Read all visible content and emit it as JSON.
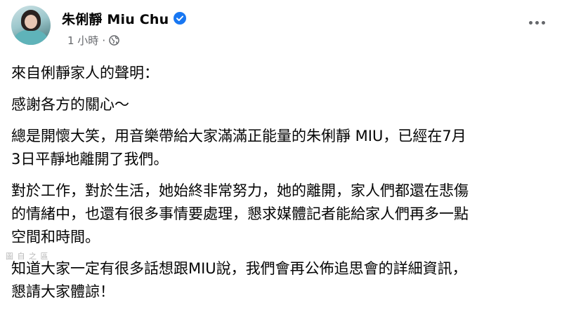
{
  "post": {
    "author_name": "朱俐靜 Miu Chu",
    "timestamp": "1 小時",
    "separator": "·",
    "paragraphs": [
      "來自俐靜家人的聲明：",
      "感謝各方的關心～",
      "總是開懷大笑，用音樂帶給大家滿滿正能量的朱俐靜 MIU，已經在7月\n3日平靜地離開了我們。",
      "對於工作，對於生活，她始終非常努力，她的離開，家人們都還在悲傷\n的情緒中，也還有很多事情要處理，懇求媒體記者能給家人們再多一點\n空間和時間。",
      "知道大家一定有很多話想跟MIU說，我們會再公佈追思會的詳細資訊，\n懇請大家體諒！"
    ],
    "icons": {
      "verified": "verified-badge-icon",
      "audience": "globe-icon",
      "menu": "more-options-icon"
    },
    "colors": {
      "verified": "#1877f2",
      "meta": "#65676b"
    }
  },
  "watermark": "圖 自 之 區"
}
